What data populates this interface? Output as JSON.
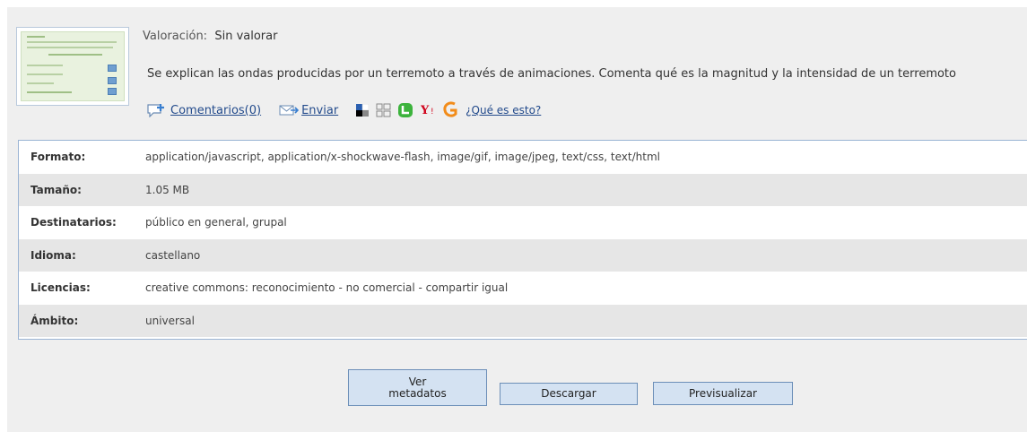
{
  "resource": {
    "rating_label": "Valoración:",
    "rating_value": "Sin valorar",
    "description": "Se explican las ondas producidas por un terremoto a través de animaciones. Comenta qué es la magnitud y la intensidad de un terremoto"
  },
  "actions": {
    "comments_label": "Comentarios(0)",
    "send_label": "Enviar",
    "what_is_label": "¿Qué es esto?",
    "icons": [
      "comment-add-icon",
      "send-mail-icon",
      "delicious-icon",
      "meneame-icon",
      "tuenti-icon",
      "yahoo-icon",
      "digg-icon"
    ]
  },
  "metadata": {
    "rows": [
      {
        "key": "Formato:",
        "value": "application/javascript, application/x-shockwave-flash, image/gif, image/jpeg, text/css, text/html"
      },
      {
        "key": "Tamaño:",
        "value": "1.05 MB"
      },
      {
        "key": "Destinatarios:",
        "value": "público en general, grupal"
      },
      {
        "key": "Idioma:",
        "value": "castellano"
      },
      {
        "key": "Licencias:",
        "value": "creative commons: reconocimiento - no comercial - compartir igual"
      },
      {
        "key": "Ámbito:",
        "value": "universal"
      }
    ]
  },
  "buttons": {
    "metadata_line1": "Ver",
    "metadata_line2": "metadatos",
    "download": "Descargar",
    "preview": "Previsualizar"
  },
  "colors": {
    "link": "#234b8c",
    "table_border": "#9ab4d4",
    "button_bg": "#d4e2f2",
    "panel_bg": "#efefef"
  }
}
